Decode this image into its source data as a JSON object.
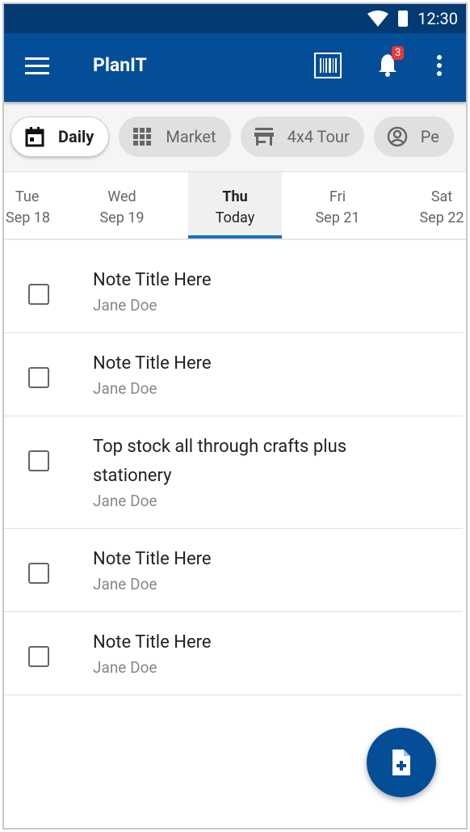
{
  "status": {
    "time": "12:30",
    "icons": [
      "wifi-icon",
      "battery-icon"
    ]
  },
  "appbar": {
    "title": "PlanIT",
    "notification_count": "3",
    "colors": {
      "primary": "#044e98",
      "status": "#033a73"
    }
  },
  "chips": [
    {
      "label": "Daily",
      "icon": "calendar-icon",
      "active": true
    },
    {
      "label": "Market",
      "icon": "grid-icon"
    },
    {
      "label": "4x4 Tour",
      "icon": "store-icon"
    },
    {
      "label": "Pe",
      "icon": "account-circle-icon"
    }
  ],
  "days": [
    {
      "day": "Tue",
      "date": "Sep 18"
    },
    {
      "day": "Wed",
      "date": "Sep 19"
    },
    {
      "day": "Thu",
      "date": "Today",
      "selected": true
    },
    {
      "day": "Fri",
      "date": "Sep 21"
    },
    {
      "day": "Sat",
      "date": "Sep 22"
    }
  ],
  "notes": [
    {
      "title": "Note Title Here",
      "author": "Jane Doe"
    },
    {
      "title": "Note Title Here",
      "author": "Jane Doe"
    },
    {
      "title": "Top stock all through crafts plus stationery",
      "author": "Jane Doe"
    },
    {
      "title": "Note Title Here",
      "author": "Jane Doe"
    },
    {
      "title": "Note Title Here",
      "author": "Jane Doe"
    }
  ],
  "fab": {
    "icon": "note-add-icon"
  }
}
